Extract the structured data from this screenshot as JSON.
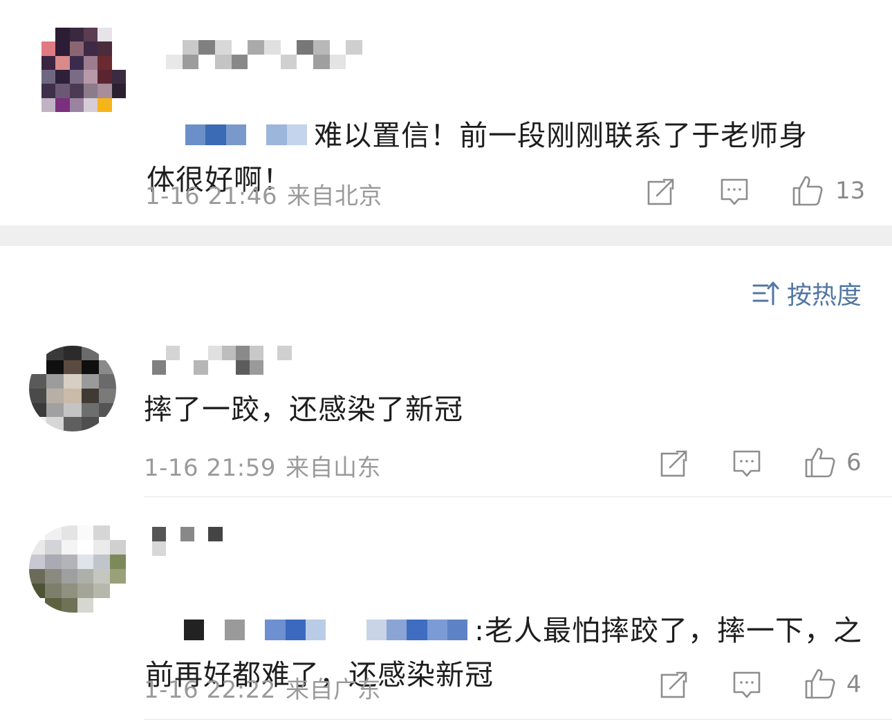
{
  "comments_top": [
    {
      "text": "难以置信！前一段刚刚联系了于老师身\n体很好啊！",
      "time": "1-16 21:46",
      "location": "来自北京",
      "likes": "13"
    }
  ],
  "sort": {
    "label": "按热度",
    "icon": "sort-hot-icon"
  },
  "comments": [
    {
      "text": "摔了一跤，还感染了新冠",
      "time": "1-16 21:59",
      "location": "来自山东",
      "likes": "6"
    },
    {
      "text": ":老人最怕摔跤了，摔一下，之\n前再好都难了，还感染新冠",
      "time": "1-16 22:22",
      "location": "来自广东",
      "likes": "4"
    }
  ],
  "icons": {
    "share": "share-icon",
    "reply": "comment-icon",
    "like": "thumbs-up-icon"
  },
  "colors": {
    "accent": "#5276a6",
    "meta": "#9a9a9a",
    "text": "#1e1e1e",
    "section_gap": "#efefef"
  }
}
